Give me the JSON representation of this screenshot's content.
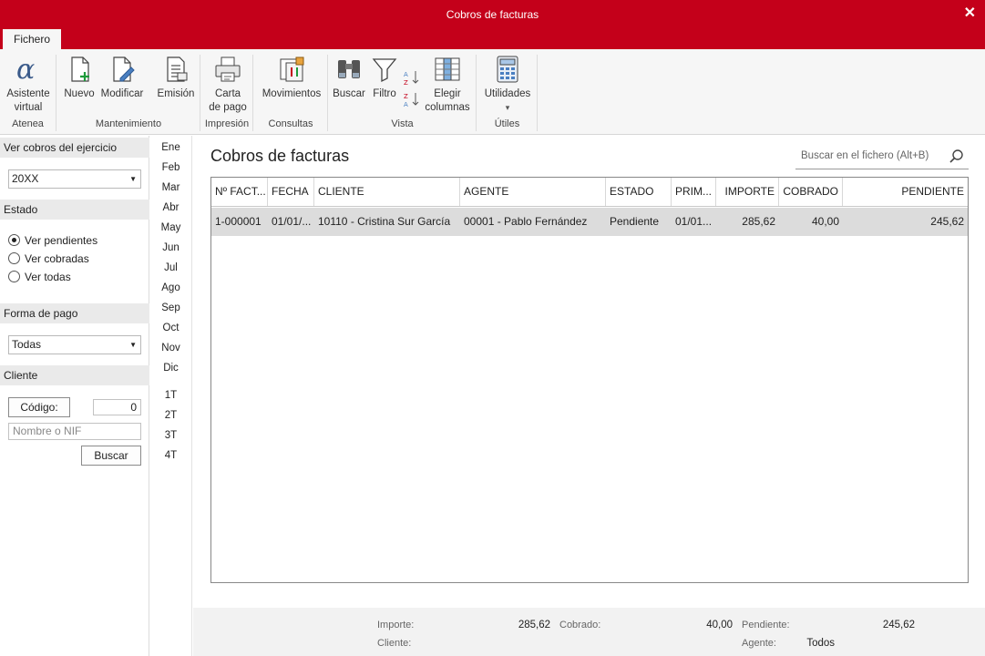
{
  "window": {
    "title": "Cobros de facturas"
  },
  "ribbon": {
    "tab_file": "Fichero",
    "groups": {
      "atenea": "Atenea",
      "mantenimiento": "Mantenimiento",
      "impresion": "Impresión",
      "consultas": "Consultas",
      "vista": "Vista",
      "utiles": "Útiles"
    },
    "buttons": {
      "asistente_1": "Asistente",
      "asistente_2": "virtual",
      "nuevo": "Nuevo",
      "modificar": "Modificar",
      "emision": "Emisión",
      "carta_1": "Carta",
      "carta_2": "de pago",
      "movimientos": "Movimientos",
      "buscar": "Buscar",
      "filtro": "Filtro",
      "elegir_1": "Elegir",
      "elegir_2": "columnas",
      "utilidades": "Utilidades",
      "utilidades_arrow": "▾"
    }
  },
  "sidebar": {
    "ejercicio_header": "Ver cobros del ejercicio",
    "ejercicio_value": "20XX",
    "estado_header": "Estado",
    "estado_options": [
      "Ver pendientes",
      "Ver cobradas",
      "Ver todas"
    ],
    "estado_selected": 0,
    "forma_pago_header": "Forma de pago",
    "forma_pago_value": "Todas",
    "cliente_header": "Cliente",
    "codigo_label": "Código:",
    "codigo_value": "0",
    "nombre_placeholder": "Nombre o NIF",
    "buscar_label": "Buscar"
  },
  "months": [
    "Ene",
    "Feb",
    "Mar",
    "Abr",
    "May",
    "Jun",
    "Jul",
    "Ago",
    "Sep",
    "Oct",
    "Nov",
    "Dic"
  ],
  "quarters": [
    "1T",
    "2T",
    "3T",
    "4T"
  ],
  "main": {
    "heading": "Cobros de facturas",
    "search_placeholder": "Buscar en el fichero (Alt+B)",
    "columns": [
      "Nº FACT...",
      "FECHA",
      "CLIENTE",
      "AGENTE",
      "ESTADO",
      "PRIM...",
      "IMPORTE",
      "COBRADO",
      "PENDIENTE"
    ],
    "rows": [
      [
        "1-000001",
        "01/01/...",
        "10110 - Cristina Sur García",
        "00001 - Pablo Fernández",
        "Pendiente",
        "01/01...",
        "285,62",
        "40,00",
        "245,62"
      ]
    ]
  },
  "footer": {
    "importe_label": "Importe:",
    "importe_value": "285,62",
    "cobrado_label": "Cobrado:",
    "cobrado_value": "40,00",
    "pendiente_label": "Pendiente:",
    "pendiente_value": "245,62",
    "cliente_label": "Cliente:",
    "agente_label": "Agente:",
    "agente_value": "Todos"
  }
}
